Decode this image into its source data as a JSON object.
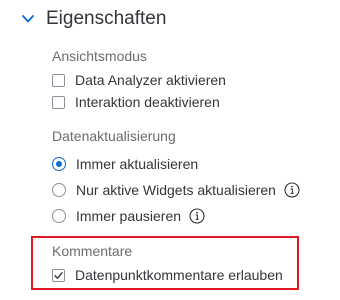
{
  "panel": {
    "title": "Eigenschaften"
  },
  "view_mode": {
    "label": "Ansichtsmodus",
    "options": [
      {
        "label": "Data Analyzer aktivieren",
        "checked": false
      },
      {
        "label": "Interaktion deaktivieren",
        "checked": false
      }
    ]
  },
  "data_refresh": {
    "label": "Datenaktualisierung",
    "options": [
      {
        "label": "Immer aktualisieren",
        "selected": true
      },
      {
        "label": "Nur aktive Widgets aktualisieren",
        "selected": false,
        "info_icon": true
      },
      {
        "label": "Immer pausieren",
        "selected": false,
        "info_icon": true
      }
    ]
  },
  "comments": {
    "label": "Kommentare",
    "options": [
      {
        "label": "Datenpunktkommentare erlauben",
        "checked": true
      }
    ]
  },
  "colors": {
    "accent": "#0a6ed1",
    "highlight_border": "#e01a22"
  }
}
